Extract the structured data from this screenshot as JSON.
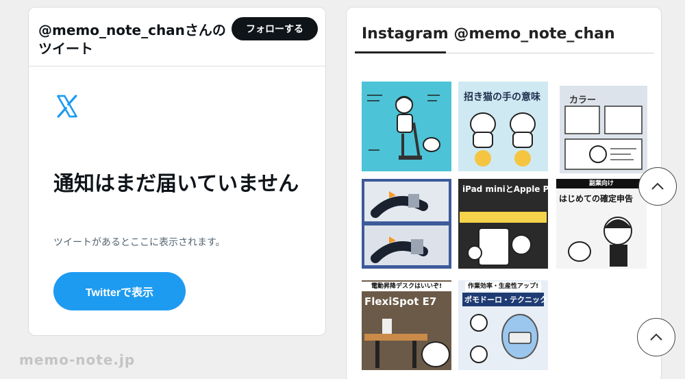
{
  "twitter": {
    "title": "@memo_note_chanさんのツイート",
    "follow_label": "フォローする",
    "heading": "通知はまだ届いていません",
    "subtext": "ツイートがあるとここに表示されます。",
    "view_button": "Twitterで表示",
    "accent": "#1d9bf0"
  },
  "instagram": {
    "title": "Instagram @memo_note_chan",
    "posts": [
      {
        "icon": "exercise-bike-illustration"
      },
      {
        "icon": "maneki-neko-illustration",
        "text": "招き猫の手の意味"
      },
      {
        "icon": "computer-desk-illustration",
        "text": "カラー"
      },
      {
        "icon": "exercise-bike-photo"
      },
      {
        "icon": "ipad-drawing-illustration",
        "text": "iPad miniとApple Pencilは"
      },
      {
        "icon": "tax-return-illustration",
        "text": "はじめての確定申告",
        "subtext": "副業向け"
      },
      {
        "icon": "standing-desk-photo",
        "text": "FlexiSpot E7",
        "subtext": "電動昇降デスクはいいぞ!"
      },
      {
        "icon": "pomodoro-timer-illustration",
        "text": "ポモドーロ・テクニック",
        "subtext": "作業効率・生産性アップ!"
      }
    ]
  },
  "scroll_buttons": {
    "icon": "chevron-up-icon"
  },
  "watermark": "memo-note.jp"
}
